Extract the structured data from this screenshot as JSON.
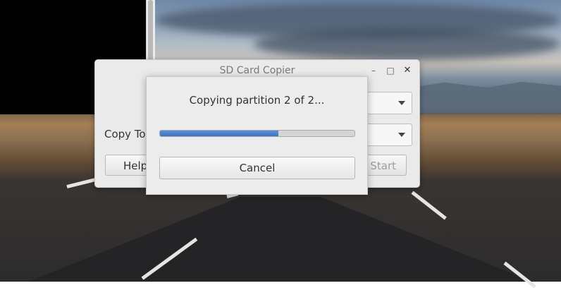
{
  "main_window": {
    "title": "SD Card Copier",
    "copy_to_label": "Copy To",
    "help_label": "Help",
    "start_label": "Start"
  },
  "progress_dialog": {
    "message": "Copying partition 2 of 2...",
    "progress": 0.61,
    "cancel_label": "Cancel"
  },
  "colors": {
    "progress_fill": "#3d73c2",
    "dialog_bg": "#ececec"
  },
  "icons": {
    "minimize": "minimize-icon",
    "maximize": "maximize-icon",
    "close": "close-icon",
    "scroll_down": "chevron-down-icon"
  }
}
